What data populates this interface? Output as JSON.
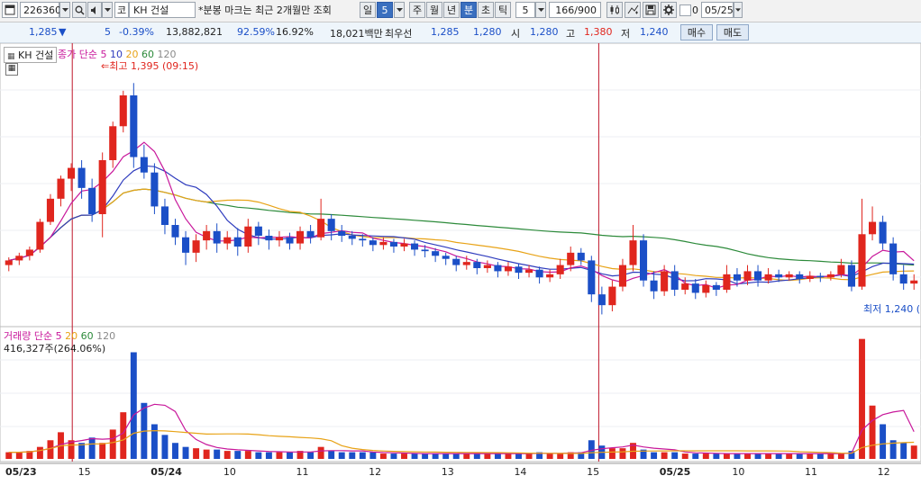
{
  "toolbar": {
    "stock_code": "226360",
    "market_label": "코",
    "stock_name": "KH 건설",
    "notice": "*분봉 마크는 최근 2개월만 조회",
    "period_tabs": [
      "일",
      "5",
      "주",
      "월",
      "년",
      "분",
      "초",
      "틱"
    ],
    "selected_tab": "분",
    "interval_value": "5",
    "count_display": "166/900",
    "date_value": "05/25",
    "checkbox_label": "0"
  },
  "quote": {
    "price": "1,285",
    "change_arrow": "▼",
    "change": "5",
    "change_rate": "-0.39%",
    "volume": "13,882,821",
    "volume_ratio": "92.59%",
    "turnover": "16.92%",
    "amount": "18,021백만",
    "best_label": "최우선",
    "best_ask": "1,285",
    "best_bid": "1,280",
    "open_label": "시",
    "open": "1,280",
    "high_label": "고",
    "high": "1,380",
    "low_label": "저",
    "low": "1,240",
    "buy_button": "매수",
    "sell_button": "매도"
  },
  "price_panel": {
    "legend_name": "KH 건설",
    "legend_ma_label": "종가 단순",
    "ma_periods": [
      "5",
      "10",
      "20",
      "60",
      "120"
    ],
    "high_annotation": "최고 1,395 (09:15)",
    "low_annotation": "최저 1,240 ("
  },
  "volume_panel": {
    "legend_label": "거래량 단순",
    "ma_periods": [
      "5",
      "20",
      "60",
      "120"
    ],
    "value_annotation": "416,327주(264.06%)"
  },
  "colors": {
    "up": "#e0261e",
    "down": "#1b4fc7",
    "ma5": "#c8189b",
    "ma10": "#2f3cbe",
    "ma20": "#e8a317",
    "ma60": "#2c8a3a",
    "ma120": "#8a8a8a",
    "session_line": "#c0162a"
  },
  "chart_data": {
    "type": "candlestick",
    "price_range": [
      1225,
      1400
    ],
    "x_labels": [
      "05/23",
      "15",
      "05/24",
      "10",
      "11",
      "12",
      "13",
      "14",
      "15",
      "05/25",
      "10",
      "11",
      "12"
    ],
    "y_annotations": {
      "high": 1395,
      "low": 1240
    },
    "candles": [
      [
        1262,
        1265,
        1258,
        1267
      ],
      [
        1265,
        1268,
        1262,
        1270
      ],
      [
        1268,
        1272,
        1265,
        1274
      ],
      [
        1272,
        1290,
        1270,
        1292
      ],
      [
        1290,
        1305,
        1288,
        1308
      ],
      [
        1305,
        1318,
        1300,
        1320
      ],
      [
        1318,
        1325,
        1310,
        1328
      ],
      [
        1325,
        1312,
        1305,
        1330
      ],
      [
        1312,
        1295,
        1290,
        1318
      ],
      [
        1295,
        1330,
        1280,
        1335
      ],
      [
        1330,
        1352,
        1325,
        1355
      ],
      [
        1352,
        1372,
        1348,
        1375
      ],
      [
        1372,
        1332,
        1325,
        1380
      ],
      [
        1332,
        1322,
        1318,
        1340
      ],
      [
        1322,
        1300,
        1295,
        1328
      ],
      [
        1300,
        1288,
        1282,
        1305
      ],
      [
        1288,
        1280,
        1275,
        1292
      ],
      [
        1280,
        1270,
        1262,
        1284
      ],
      [
        1270,
        1278,
        1264,
        1282
      ],
      [
        1278,
        1284,
        1272,
        1288
      ],
      [
        1284,
        1276,
        1270,
        1289
      ],
      [
        1276,
        1280,
        1272,
        1284
      ],
      [
        1280,
        1274,
        1268,
        1286
      ],
      [
        1274,
        1287,
        1270,
        1292
      ],
      [
        1287,
        1281,
        1275,
        1290
      ],
      [
        1281,
        1278,
        1272,
        1285
      ],
      [
        1278,
        1280,
        1274,
        1284
      ],
      [
        1280,
        1276,
        1272,
        1283
      ],
      [
        1276,
        1284,
        1272,
        1287
      ],
      [
        1284,
        1280,
        1276,
        1288
      ],
      [
        1280,
        1292,
        1278,
        1305
      ],
      [
        1292,
        1284,
        1278,
        1295
      ],
      [
        1284,
        1281,
        1277,
        1288
      ],
      [
        1281,
        1279,
        1275,
        1284
      ],
      [
        1279,
        1278,
        1274,
        1282
      ],
      [
        1278,
        1275,
        1271,
        1280
      ],
      [
        1275,
        1277,
        1272,
        1280
      ],
      [
        1277,
        1274,
        1270,
        1279
      ],
      [
        1274,
        1276,
        1271,
        1279
      ],
      [
        1276,
        1272,
        1268,
        1278
      ],
      [
        1272,
        1271,
        1267,
        1275
      ],
      [
        1271,
        1268,
        1264,
        1273
      ],
      [
        1268,
        1266,
        1262,
        1270
      ],
      [
        1266,
        1262,
        1258,
        1268
      ],
      [
        1262,
        1264,
        1259,
        1268
      ],
      [
        1264,
        1260,
        1256,
        1266
      ],
      [
        1260,
        1262,
        1257,
        1265
      ],
      [
        1262,
        1258,
        1254,
        1264
      ],
      [
        1258,
        1261,
        1255,
        1264
      ],
      [
        1261,
        1257,
        1253,
        1263
      ],
      [
        1257,
        1259,
        1254,
        1262
      ],
      [
        1259,
        1254,
        1250,
        1261
      ],
      [
        1254,
        1256,
        1251,
        1259
      ],
      [
        1256,
        1262,
        1253,
        1266
      ],
      [
        1262,
        1270,
        1258,
        1274
      ],
      [
        1270,
        1265,
        1262,
        1273
      ],
      [
        1265,
        1243,
        1238,
        1268
      ],
      [
        1243,
        1236,
        1230,
        1248
      ],
      [
        1236,
        1248,
        1232,
        1252
      ],
      [
        1248,
        1262,
        1245,
        1266
      ],
      [
        1262,
        1278,
        1258,
        1288
      ],
      [
        1278,
        1252,
        1248,
        1282
      ],
      [
        1252,
        1245,
        1240,
        1258
      ],
      [
        1245,
        1258,
        1242,
        1262
      ],
      [
        1258,
        1246,
        1242,
        1262
      ],
      [
        1246,
        1250,
        1243,
        1254
      ],
      [
        1250,
        1244,
        1240,
        1253
      ],
      [
        1244,
        1249,
        1241,
        1252
      ],
      [
        1249,
        1246,
        1242,
        1251
      ],
      [
        1246,
        1256,
        1244,
        1262
      ],
      [
        1256,
        1252,
        1248,
        1260
      ],
      [
        1252,
        1258,
        1249,
        1262
      ],
      [
        1258,
        1252,
        1248,
        1262
      ],
      [
        1252,
        1256,
        1250,
        1260
      ],
      [
        1256,
        1254,
        1251,
        1259
      ],
      [
        1254,
        1256,
        1252,
        1258
      ],
      [
        1256,
        1253,
        1250,
        1258
      ],
      [
        1253,
        1255,
        1251,
        1258
      ],
      [
        1255,
        1254,
        1251,
        1257
      ],
      [
        1254,
        1256,
        1252,
        1258
      ],
      [
        1256,
        1262,
        1254,
        1266
      ],
      [
        1262,
        1248,
        1245,
        1265
      ],
      [
        1248,
        1282,
        1246,
        1305
      ],
      [
        1282,
        1290,
        1278,
        1300
      ],
      [
        1290,
        1276,
        1272,
        1294
      ],
      [
        1276,
        1256,
        1252,
        1280
      ],
      [
        1256,
        1250,
        1246,
        1262
      ],
      [
        1250,
        1252,
        1246,
        1256
      ]
    ],
    "volumes": [
      5,
      5,
      6,
      9,
      14,
      20,
      14,
      12,
      16,
      12,
      22,
      35,
      80,
      42,
      26,
      18,
      12,
      9,
      8,
      7,
      7,
      6,
      6,
      6,
      5,
      5,
      5,
      5,
      6,
      5,
      9,
      6,
      5,
      5,
      5,
      5,
      4,
      4,
      4,
      4,
      4,
      4,
      4,
      4,
      4,
      4,
      4,
      4,
      4,
      4,
      4,
      5,
      4,
      4,
      5,
      5,
      14,
      10,
      8,
      8,
      12,
      7,
      5,
      5,
      5,
      4,
      4,
      4,
      4,
      4,
      4,
      4,
      4,
      4,
      4,
      4,
      4,
      4,
      4,
      4,
      4,
      6,
      90,
      40,
      26,
      14,
      12,
      10
    ],
    "series": [
      {
        "name": "5",
        "color": "#c8189b"
      },
      {
        "name": "10",
        "color": "#2f3cbe"
      },
      {
        "name": "20",
        "color": "#e8a317"
      },
      {
        "name": "60",
        "color": "#2c8a3a"
      },
      {
        "name": "120",
        "color": "#8a8a8a"
      }
    ]
  }
}
